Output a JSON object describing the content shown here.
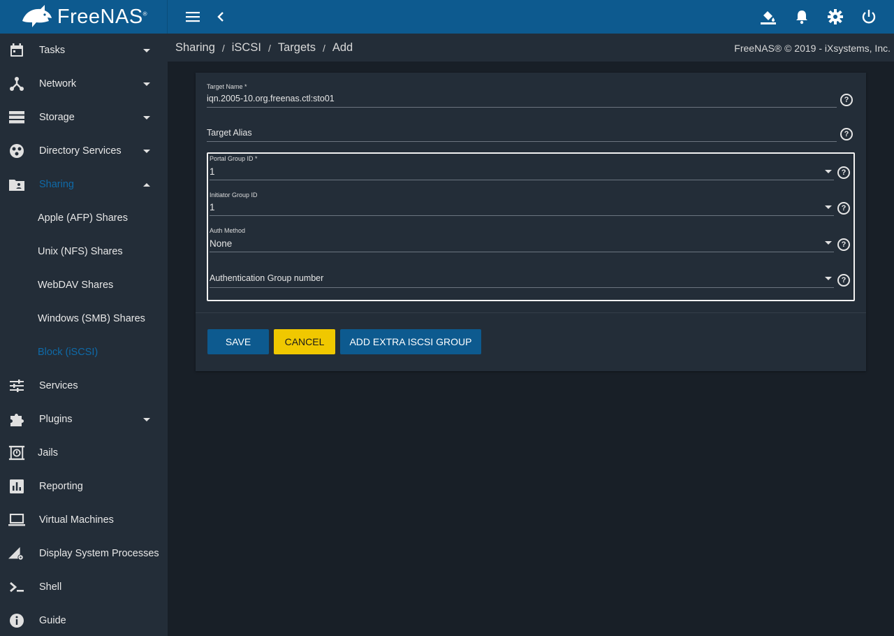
{
  "header": {
    "brand": "FreeNAS",
    "brand_mark": "®"
  },
  "sidebar": {
    "items": [
      {
        "label": "Tasks",
        "icon": "calendar-icon"
      },
      {
        "label": "Network",
        "icon": "network-icon"
      },
      {
        "label": "Storage",
        "icon": "storage-icon"
      },
      {
        "label": "Directory Services",
        "icon": "directory-services-icon"
      },
      {
        "label": "Sharing",
        "icon": "folder-shared-icon"
      },
      {
        "label": "Services",
        "icon": "tune-icon"
      },
      {
        "label": "Plugins",
        "icon": "puzzle-icon"
      },
      {
        "label": "Jails",
        "icon": "jail-icon"
      },
      {
        "label": "Reporting",
        "icon": "chart-icon"
      },
      {
        "label": "Virtual Machines",
        "icon": "laptop-icon"
      },
      {
        "label": "Display System Processes",
        "icon": "processes-icon"
      },
      {
        "label": "Shell",
        "icon": "terminal-icon"
      },
      {
        "label": "Guide",
        "icon": "info-icon"
      }
    ],
    "sharing_sub": [
      {
        "label": "Apple (AFP) Shares"
      },
      {
        "label": "Unix (NFS) Shares"
      },
      {
        "label": "WebDAV Shares"
      },
      {
        "label": "Windows (SMB) Shares"
      },
      {
        "label": "Block (iSCSI)"
      }
    ]
  },
  "breadcrumb": {
    "items": [
      "Sharing",
      "iSCSI",
      "Targets",
      "Add"
    ],
    "separator": "/",
    "copyright": "FreeNAS® © 2019 - iXsystems, Inc."
  },
  "form": {
    "target_name_label": "Target Name *",
    "target_name_value": "iqn.2005-10.org.freenas.ctl:sto01",
    "target_alias_placeholder": "Target Alias",
    "portal_group_label": "Portal Group ID *",
    "portal_group_value": "1",
    "initiator_group_label": "Initiator Group ID",
    "initiator_group_value": "1",
    "auth_method_label": "Auth Method",
    "auth_method_value": "None",
    "auth_group_placeholder": "Authentication Group number",
    "help_glyph": "?"
  },
  "buttons": {
    "save": "SAVE",
    "cancel": "CANCEL",
    "add_extra": "ADD EXTRA ISCSI GROUP"
  },
  "colors": {
    "topbar": "#0d5a8f",
    "sidebar": "#232d38",
    "background": "#181f27",
    "accent_active": "#0f6aa8",
    "cancel": "#f0c800"
  }
}
